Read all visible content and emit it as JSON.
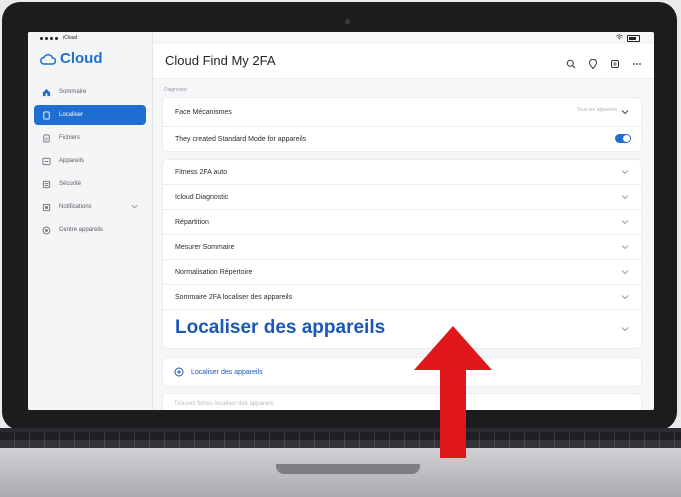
{
  "status_bar": {
    "carrier": "iCloud",
    "center": "",
    "signal_label": ""
  },
  "sidebar": {
    "brand": "Cloud",
    "items": [
      {
        "label": "Sommaire",
        "icon": "home-icon",
        "active": false
      },
      {
        "label": "Localiser",
        "icon": "doc-icon",
        "active": true
      },
      {
        "label": "Fichiers",
        "icon": "file-icon",
        "active": false
      },
      {
        "label": "Appareils",
        "icon": "device-icon",
        "active": false
      },
      {
        "label": "Sécurité",
        "icon": "lock-icon",
        "active": false
      },
      {
        "label": "Notifications",
        "icon": "bell-icon",
        "active": false
      },
      {
        "label": "Centre appareils",
        "icon": "shield-icon",
        "active": false
      }
    ]
  },
  "header": {
    "title": "Cloud Find My 2FA"
  },
  "breadcrumb": "Diagnostic",
  "settings_card": {
    "rows": [
      {
        "label": "Face Mécanismes",
        "hint": "Tous les appareils"
      },
      {
        "label": "They created Standard Mode for appareils",
        "toggle": true
      }
    ]
  },
  "list_card": {
    "rows": [
      {
        "label": "Fitness 2FA auto",
        "dim": false
      },
      {
        "label": "Icloud Diagnostic",
        "dim": false
      },
      {
        "label": "Répartition",
        "dim": false
      },
      {
        "label": "Mesurer Sommaire",
        "dim": false
      },
      {
        "label": "Normalisation Répertoire",
        "dim": false
      },
      {
        "label": "Sommaire 2FA localiser des appareils",
        "dim": false
      }
    ],
    "big_row": "Localiser des appareils"
  },
  "locate_action": {
    "label": "Localiser des appareils"
  },
  "ghost_row": {
    "label": "Trouvez fiches localiser des appareils"
  },
  "colors": {
    "accent": "#1f6fd1",
    "arrow": "#e0171b"
  }
}
